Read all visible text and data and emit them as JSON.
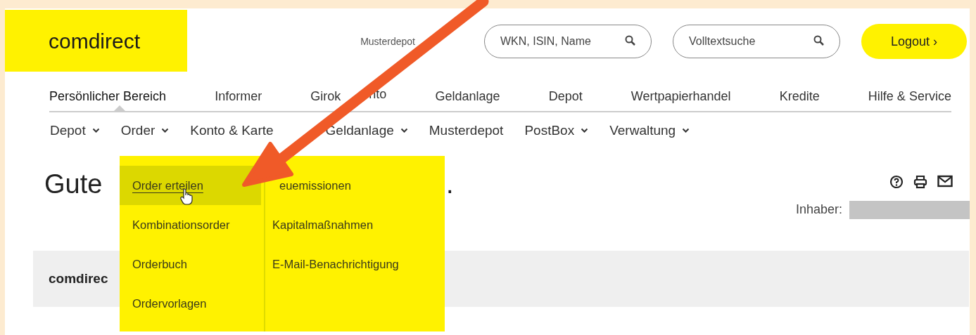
{
  "header": {
    "logo": "comdirect",
    "account_link": "Musterdepot",
    "search": {
      "placeholder": "WKN, ISIN, Name"
    },
    "fulltext_search": {
      "placeholder": "Volltextsuche"
    },
    "logout": "Logout ›"
  },
  "main_nav": [
    {
      "label": "Persönlicher Bereich",
      "selected": true
    },
    {
      "label": "Informer",
      "selected": false
    },
    {
      "label": "Girok",
      "label_tail": "nto",
      "selected": false
    },
    {
      "label": "Geldanlage",
      "selected": false
    },
    {
      "label": "Depot",
      "selected": false
    },
    {
      "label": "Wertpapierhandel",
      "selected": false
    },
    {
      "label": "Kredite",
      "selected": false
    },
    {
      "label": "Hilfe & Service",
      "selected": false
    }
  ],
  "sub_nav": [
    {
      "label": "Depot",
      "dropdown": true
    },
    {
      "label": "Order",
      "dropdown": true
    },
    {
      "label": "Konto & Karte",
      "dropdown": false
    },
    {
      "label": "Geldanlage",
      "dropdown": true
    },
    {
      "label": "Musterdepot",
      "dropdown": false
    },
    {
      "label": "PostBox",
      "dropdown": true
    },
    {
      "label": "Verwaltung",
      "dropdown": true
    }
  ],
  "dropdown_menu": {
    "columns": [
      [
        {
          "label": "Order erteilen",
          "selected": true
        },
        {
          "label": "Kombinationsorder",
          "selected": false
        },
        {
          "label": "Orderbuch",
          "selected": false
        },
        {
          "label": "Ordervorlagen",
          "selected": false
        }
      ],
      [
        {
          "label": "euemissionen",
          "selected": false
        },
        {
          "label": "Kapitalmaßnahmen",
          "selected": false
        },
        {
          "label": "E-Mail-Benachrichtigung",
          "selected": false
        }
      ]
    ]
  },
  "greeting": {
    "start": "Gute",
    "end": "."
  },
  "owner_label": "Inhaber:",
  "section_title": "comdirec"
}
